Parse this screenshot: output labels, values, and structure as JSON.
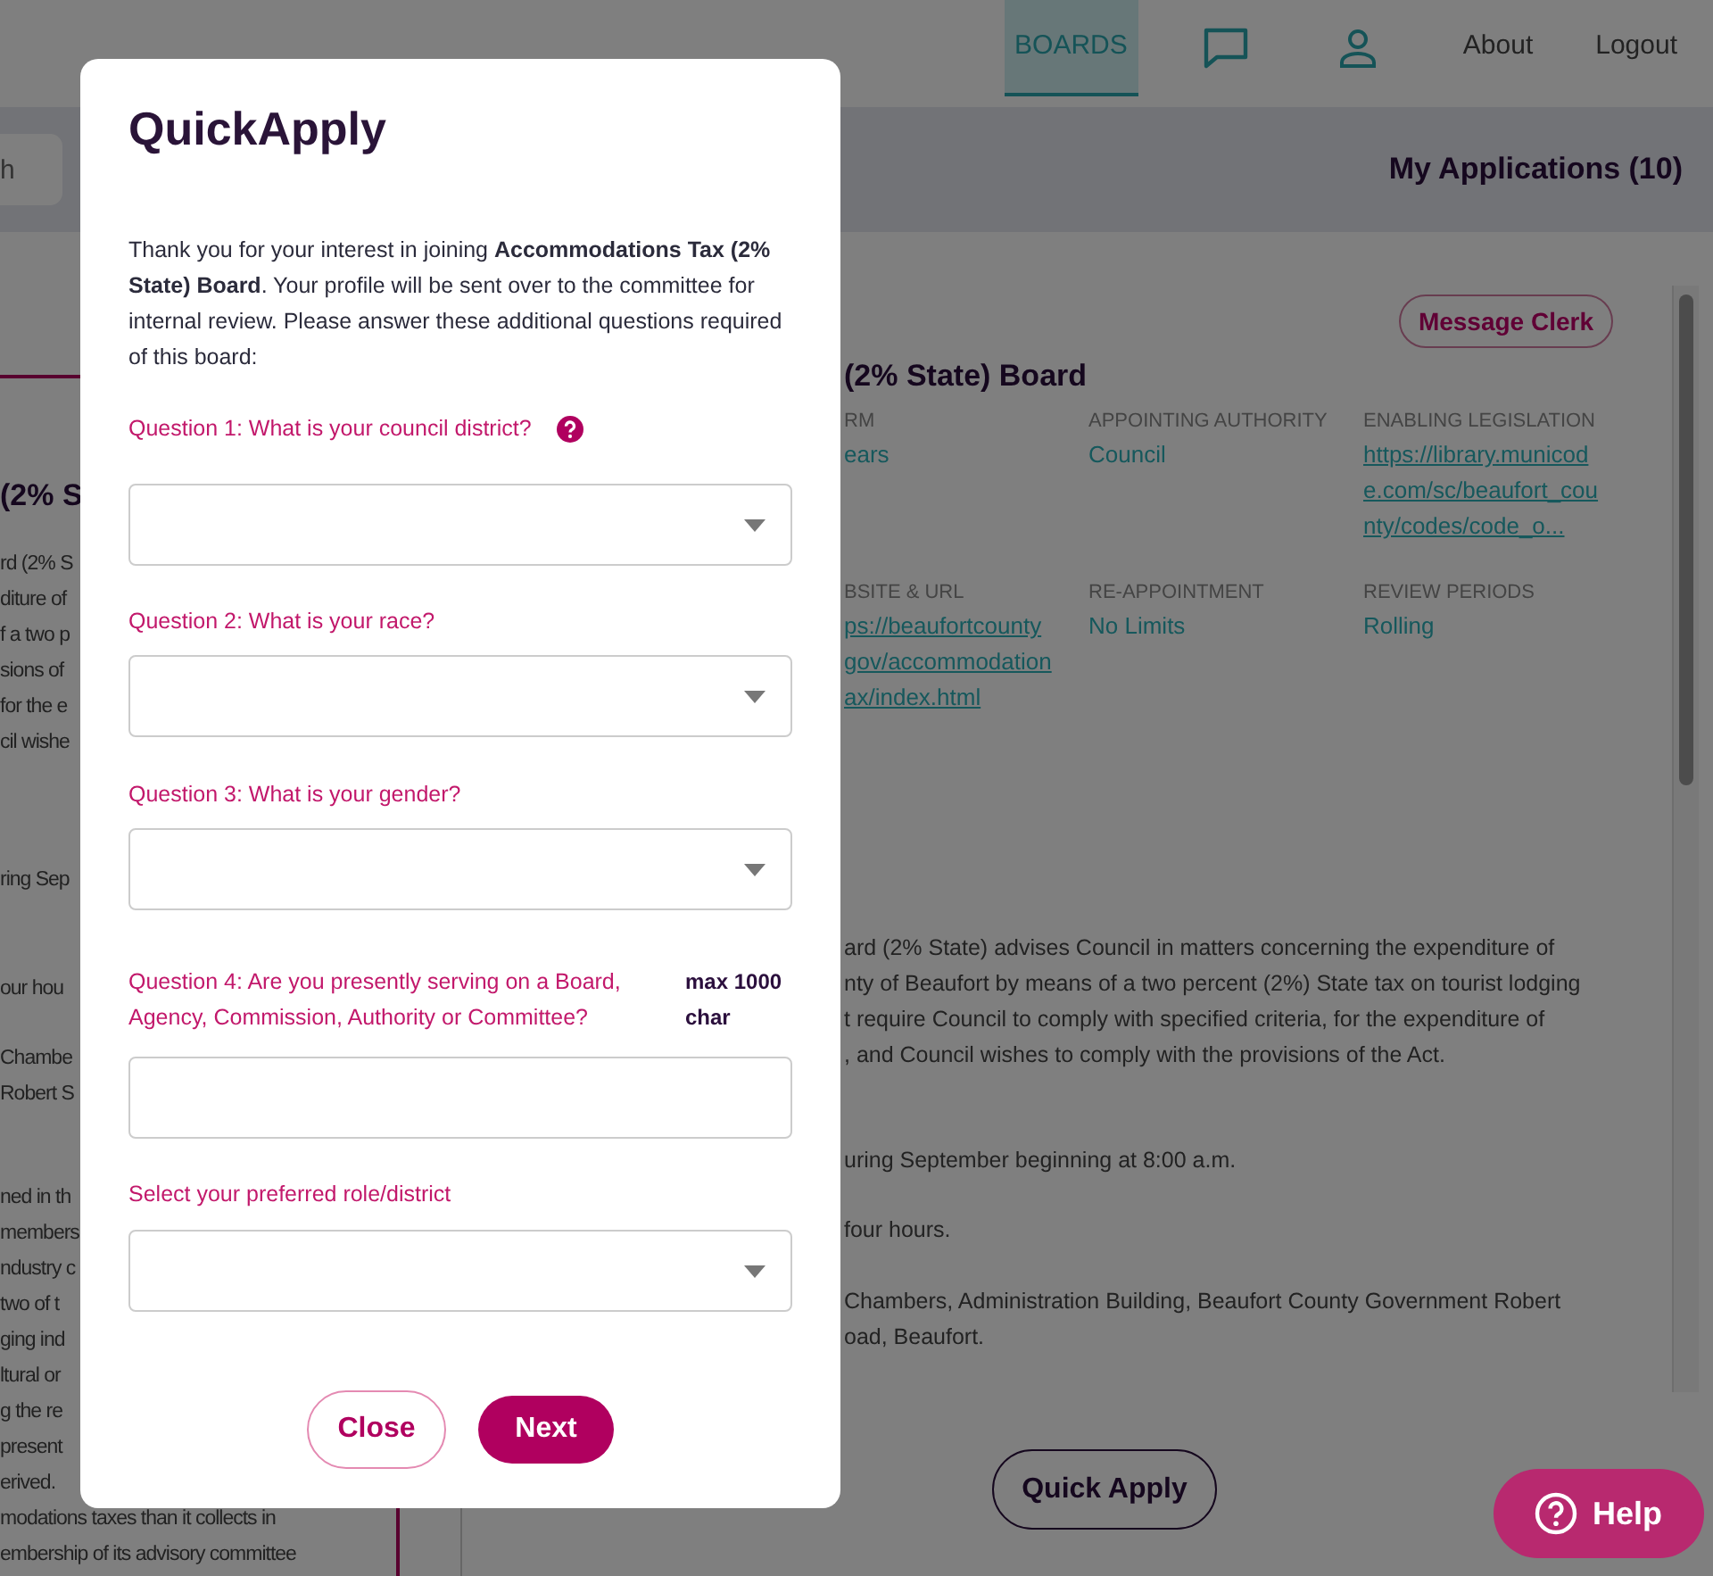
{
  "nav": [
    {
      "kind": "link",
      "label": "BOARDS",
      "selected": true
    },
    {
      "kind": "chat",
      "selected": false
    },
    {
      "kind": "user",
      "selected": false
    },
    {
      "kind": "link",
      "label": "About",
      "selected": false
    },
    {
      "kind": "link",
      "label": "Logout",
      "selected": false
    }
  ],
  "toolbar": {
    "search": {
      "placeholder": "h"
    },
    "applications": "My Applications (10)"
  },
  "left_panel": {
    "heading": "(2% S",
    "paragraphs": [
      [
        "rd (2% S",
        "diture of",
        "f a two p",
        "sions of",
        "for the e",
        "cil wishe"
      ],
      [
        "ring Sep"
      ],
      [
        "our hou"
      ],
      [
        "Chambe",
        "Robert S"
      ],
      [
        "ned in th",
        "members",
        "ndustry c",
        "two of t",
        "ging ind",
        "ltural or",
        "g the re",
        "present",
        "erived.",
        "modations taxes than it collects in",
        "embership of its advisory committee"
      ]
    ]
  },
  "board": {
    "message_button": "Message Clerk",
    "title": "(2% State) Board",
    "fields": [
      {
        "kind": "text",
        "label": "RM",
        "value": [
          "ears"
        ]
      },
      {
        "kind": "text",
        "label": "APPOINTING AUTHORITY",
        "value": [
          "Council"
        ]
      },
      {
        "kind": "link",
        "label": "ENABLING LEGISLATION",
        "value": [
          "https://library.municod",
          "e.com/sc/beaufort_cou",
          "nty/codes/code_o..."
        ]
      },
      {
        "kind": "link",
        "label": "BSITE & URL",
        "value": [
          "ps://beaufortcounty",
          "gov/accommodation",
          "ax/index.html"
        ]
      },
      {
        "kind": "text",
        "label": "RE-APPOINTMENT",
        "value": [
          "No Limits"
        ]
      },
      {
        "kind": "text",
        "label": "REVIEW PERIODS",
        "value": [
          "Rolling"
        ]
      }
    ],
    "paragraphs": [
      [
        "ard (2% State) advises Council in matters concerning the expenditure of",
        "nty of Beaufort by means of a two percent (2%) State tax on tourist lodging",
        "t require Council to comply with specified criteria, for the expenditure of",
        ", and Council wishes to comply with the provisions of the Act."
      ],
      [
        "uring September beginning at 8:00 a.m."
      ],
      [
        "four hours."
      ],
      [
        "Chambers, Administration Building, Beaufort County Government Robert",
        "oad, Beaufort."
      ]
    ],
    "apply_button": "Quick Apply"
  },
  "modal": {
    "title": "QuickApply",
    "intro": "Thank you for your interest in joining **Accommodations Tax (2% State) Board**. Your profile will be sent over to the committee for internal review. Please answer these additional questions required of this board:",
    "questions": [
      {
        "kind": "select",
        "label": "Question 1: What is your council district?",
        "help": true
      },
      {
        "kind": "select",
        "label": "Question 2: What is your race?",
        "help": false
      },
      {
        "kind": "select",
        "label": "Question 3: What is your gender?",
        "help": false
      },
      {
        "kind": "text",
        "label": "Question 4: Are you presently serving on a Board, Agency, Commission, Authority or Committee?",
        "limit": "max 1000 char",
        "help": false
      },
      {
        "kind": "select",
        "label": "Select your preferred role/district",
        "help": false
      }
    ],
    "buttons": [
      {
        "kind": "outline",
        "label": "Close"
      },
      {
        "kind": "primary",
        "label": "Next"
      }
    ]
  },
  "help_button": "Help"
}
